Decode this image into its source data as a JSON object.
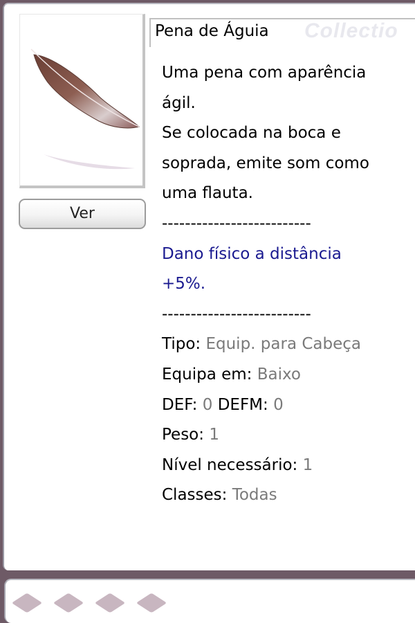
{
  "window": {
    "title": "Pena de Águia",
    "watermark": "Collectio"
  },
  "image_panel": {
    "icon": "feather-icon",
    "view_button_label": "Ver"
  },
  "description": {
    "lines": [
      "Uma pena com aparência",
      "ágil.",
      "Se colocada na boca e",
      "soprada, emite som como",
      "uma flauta."
    ],
    "separator": "--------------------------",
    "effect_lines": [
      "Dano físico a distância",
      "+5%."
    ]
  },
  "properties": {
    "tipo_label": "Tipo:",
    "tipo_value": "Equip. para Cabeça",
    "equipa_label": "Equipa em:",
    "equipa_value": "Baixo",
    "def_label": "DEF:",
    "def_value": "0",
    "defm_label": "DEFM:",
    "defm_value": "0",
    "peso_label": "Peso:",
    "peso_value": "1",
    "nivel_label": "Nível necessário:",
    "nivel_value": "1",
    "classes_label": "Classes:",
    "classes_value": "Todas"
  },
  "card_slots": {
    "count": 4,
    "icon": "empty-card-slot-icon"
  },
  "colors": {
    "effect_text": "#1a1a90",
    "value_text": "#7a7a7a",
    "slot": "#c8b6c0"
  }
}
